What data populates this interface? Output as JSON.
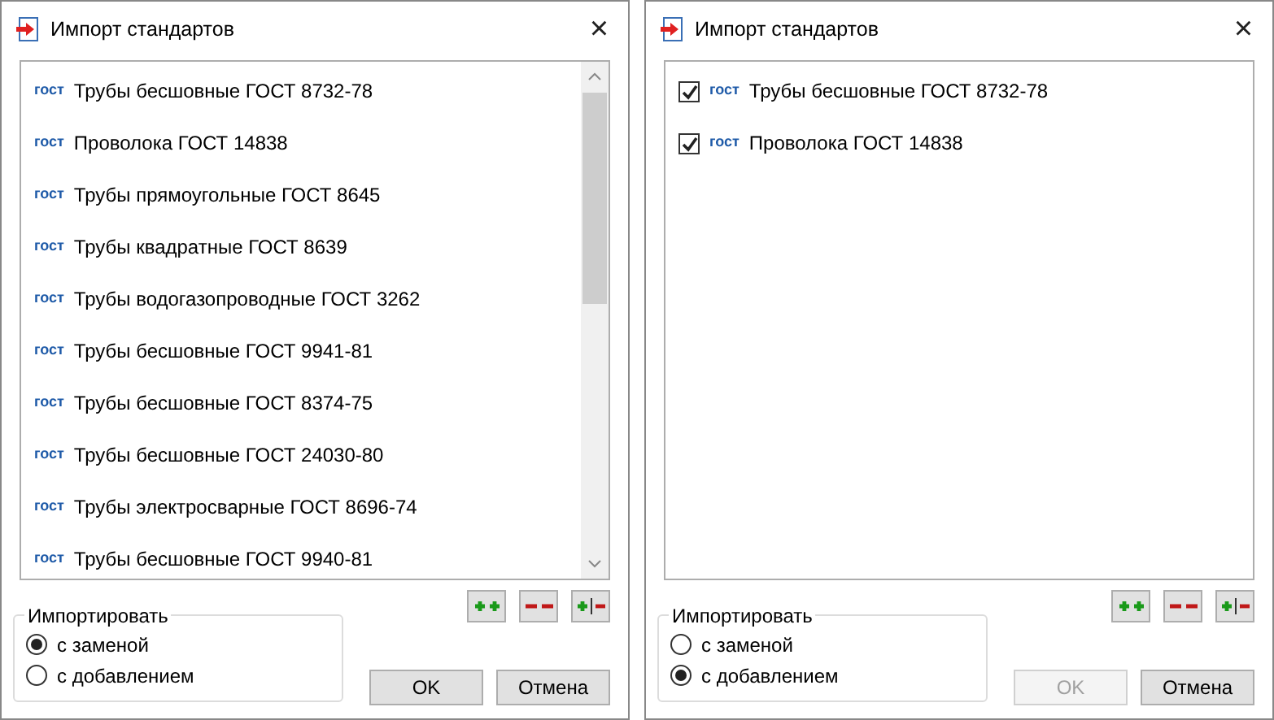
{
  "dialogs": [
    {
      "window": {
        "title": "Импорт стандартов",
        "close": "×"
      },
      "list": {
        "kind": "plain",
        "scrollbar": true,
        "items": [
          {
            "tag": "гост",
            "label": "Трубы бесшовные ГОСТ 8732-78"
          },
          {
            "tag": "гост",
            "label": "Проволока ГОСТ 14838"
          },
          {
            "tag": "гост",
            "label": "Трубы прямоугольные ГОСТ 8645"
          },
          {
            "tag": "гост",
            "label": "Трубы квадратные ГОСТ 8639"
          },
          {
            "tag": "гост",
            "label": "Трубы водогазопроводные ГОСТ 3262"
          },
          {
            "tag": "гост",
            "label": "Трубы бесшовные ГОСТ 9941-81"
          },
          {
            "tag": "гост",
            "label": "Трубы бесшовные ГОСТ 8374-75"
          },
          {
            "tag": "гост",
            "label": "Трубы бесшовные ГОСТ 24030-80"
          },
          {
            "tag": "гост",
            "label": "Трубы электросварные ГОСТ 8696-74"
          },
          {
            "tag": "гост",
            "label": "Трубы бесшовные ГОСТ 9940-81"
          }
        ]
      },
      "import_group": {
        "legend": "Импортировать",
        "options": [
          {
            "label": "с заменой",
            "selected": true
          },
          {
            "label": "с добавлением",
            "selected": false
          }
        ]
      },
      "buttons": [
        {
          "label": "OK",
          "disabled": false
        },
        {
          "label": "Отмена",
          "disabled": false
        }
      ]
    },
    {
      "window": {
        "title": "Импорт стандартов",
        "close": "×"
      },
      "list": {
        "kind": "checklist",
        "scrollbar": false,
        "items": [
          {
            "tag": "гост",
            "label": "Трубы бесшовные ГОСТ 8732-78",
            "checked": true
          },
          {
            "tag": "гост",
            "label": "Проволока ГОСТ 14838",
            "checked": true
          }
        ]
      },
      "import_group": {
        "legend": "Импортировать",
        "options": [
          {
            "label": "с заменой",
            "selected": false
          },
          {
            "label": "с добавлением",
            "selected": true
          }
        ]
      },
      "buttons": [
        {
          "label": "OK",
          "disabled": true
        },
        {
          "label": "Отмена",
          "disabled": false
        }
      ]
    }
  ]
}
